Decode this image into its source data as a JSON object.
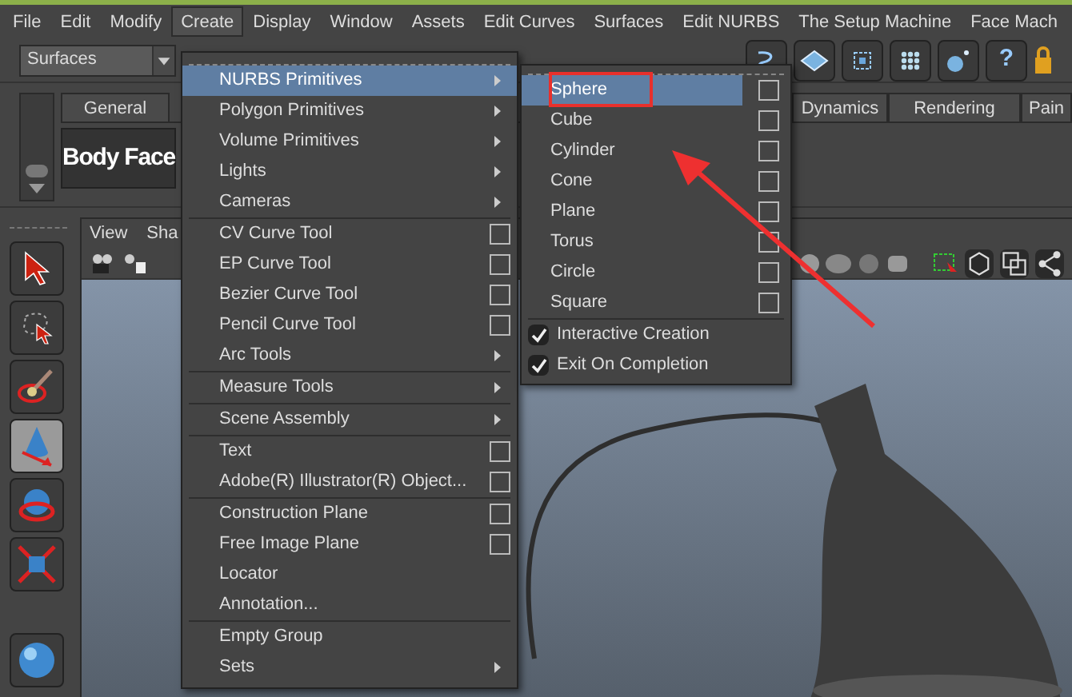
{
  "menubar": [
    {
      "label": "File",
      "selected": false
    },
    {
      "label": "Edit",
      "selected": false
    },
    {
      "label": "Modify",
      "selected": false
    },
    {
      "label": "Create",
      "selected": true
    },
    {
      "label": "Display",
      "selected": false
    },
    {
      "label": "Window",
      "selected": false
    },
    {
      "label": "Assets",
      "selected": false
    },
    {
      "label": "Edit Curves",
      "selected": false
    },
    {
      "label": "Surfaces",
      "selected": false
    },
    {
      "label": "Edit NURBS",
      "selected": false
    },
    {
      "label": "The Setup Machine",
      "selected": false
    },
    {
      "label": "Face Mach",
      "selected": false
    }
  ],
  "toolbar": {
    "mode_dropdown": "Surfaces",
    "help_glyph": "?"
  },
  "shelf": {
    "tabs_left": [
      "General"
    ],
    "tabs_right": [
      "Dynamics",
      "Rendering",
      "Pain"
    ],
    "button": "Body Face"
  },
  "viewport": {
    "menu": [
      "View",
      "Sha"
    ]
  },
  "create_menu": {
    "groups": [
      [
        {
          "label": "NURBS Primitives",
          "kind": "submenu",
          "selected": true
        },
        {
          "label": "Polygon Primitives",
          "kind": "submenu",
          "selected": false
        },
        {
          "label": "Volume Primitives",
          "kind": "submenu",
          "selected": false
        },
        {
          "label": "Lights",
          "kind": "submenu",
          "selected": false
        },
        {
          "label": "Cameras",
          "kind": "submenu",
          "selected": false
        }
      ],
      [
        {
          "label": "CV Curve Tool",
          "kind": "option",
          "selected": false
        },
        {
          "label": "EP Curve Tool",
          "kind": "option",
          "selected": false
        },
        {
          "label": "Bezier Curve Tool",
          "kind": "option",
          "selected": false
        },
        {
          "label": "Pencil Curve Tool",
          "kind": "option",
          "selected": false
        },
        {
          "label": "Arc Tools",
          "kind": "submenu",
          "selected": false
        }
      ],
      [
        {
          "label": "Measure Tools",
          "kind": "submenu",
          "selected": false
        }
      ],
      [
        {
          "label": "Scene Assembly",
          "kind": "submenu",
          "selected": false
        }
      ],
      [
        {
          "label": "Text",
          "kind": "option",
          "selected": false
        },
        {
          "label": "Adobe(R) Illustrator(R) Object...",
          "kind": "option",
          "selected": false
        }
      ],
      [
        {
          "label": "Construction Plane",
          "kind": "option",
          "selected": false
        },
        {
          "label": "Free Image Plane",
          "kind": "option",
          "selected": false
        },
        {
          "label": "Locator",
          "kind": "plain",
          "selected": false
        },
        {
          "label": "Annotation...",
          "kind": "plain",
          "selected": false
        }
      ],
      [
        {
          "label": "Empty Group",
          "kind": "plain",
          "selected": false
        },
        {
          "label": "Sets",
          "kind": "submenu",
          "selected": false
        }
      ]
    ]
  },
  "nurbs_submenu": {
    "items": [
      {
        "label": "Sphere",
        "selected": true,
        "highlighted_box": true
      },
      {
        "label": "Cube",
        "selected": false,
        "highlighted_box": false
      },
      {
        "label": "Cylinder",
        "selected": false,
        "highlighted_box": false
      },
      {
        "label": "Cone",
        "selected": false,
        "highlighted_box": false
      },
      {
        "label": "Plane",
        "selected": false,
        "highlighted_box": false
      },
      {
        "label": "Torus",
        "selected": false,
        "highlighted_box": false
      },
      {
        "label": "Circle",
        "selected": false,
        "highlighted_box": false
      },
      {
        "label": "Square",
        "selected": false,
        "highlighted_box": false
      }
    ],
    "toggles": [
      {
        "label": "Interactive Creation",
        "checked": true
      },
      {
        "label": "Exit On Completion",
        "checked": true
      }
    ]
  }
}
